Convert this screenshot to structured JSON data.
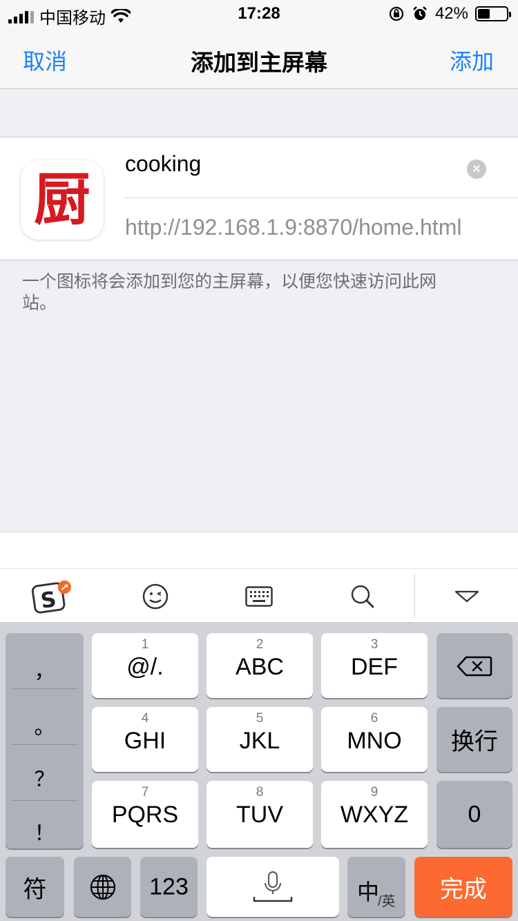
{
  "status_bar": {
    "carrier": "中国移动",
    "time": "17:28",
    "battery": "42%",
    "battery_level": 0.42
  },
  "nav": {
    "cancel": "取消",
    "title": "添加到主屏幕",
    "add": "添加"
  },
  "form": {
    "icon_glyph": "厨",
    "name_value": "cooking",
    "url": "http://192.168.1.9:8870/home.html"
  },
  "hint": "一个图标将会添加到您的主屏幕，以便您快速访问此网站。",
  "keyboard": {
    "punctuation": [
      "，",
      "。",
      "？",
      "！"
    ],
    "keys": [
      {
        "num": "1",
        "label": "@/."
      },
      {
        "num": "2",
        "label": "ABC"
      },
      {
        "num": "3",
        "label": "DEF"
      },
      {
        "num": "4",
        "label": "GHI"
      },
      {
        "num": "5",
        "label": "JKL"
      },
      {
        "num": "6",
        "label": "MNO"
      },
      {
        "num": "7",
        "label": "PQRS"
      },
      {
        "num": "8",
        "label": "TUV"
      },
      {
        "num": "9",
        "label": "WXYZ"
      }
    ],
    "return_label": "换行",
    "zero_label": "0",
    "symbols_label": "符",
    "num_label": "123",
    "lang_main": "中",
    "lang_sub": "/英",
    "done_label": "完成",
    "accent_color": "#fc6a31"
  }
}
